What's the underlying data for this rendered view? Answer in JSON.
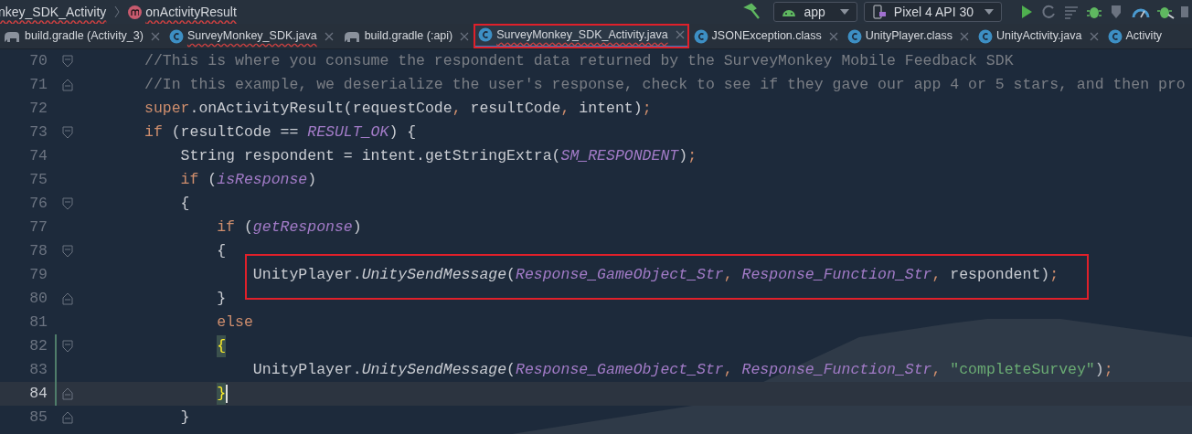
{
  "breadcrumb": {
    "items": [
      {
        "kind": "class",
        "text": "nkey_SDK_Activity",
        "errors": true
      },
      {
        "kind": "method",
        "text": "onActivityResult",
        "errors": true
      }
    ]
  },
  "toolbar": {
    "run_config": "app",
    "device": "Pixel 4 API 30"
  },
  "tabs": [
    {
      "label": "build.gradle (Activity_3)",
      "kind": "gradle",
      "selected": false,
      "errors": false,
      "annotated": false,
      "closable": true
    },
    {
      "label": "SurveyMonkey_SDK.java",
      "kind": "class",
      "selected": false,
      "errors": true,
      "annotated": false,
      "closable": true
    },
    {
      "label": "build.gradle (:api)",
      "kind": "gradle",
      "selected": false,
      "errors": false,
      "annotated": false,
      "closable": true
    },
    {
      "label": "SurveyMonkey_SDK_Activity.java",
      "kind": "class",
      "selected": true,
      "errors": true,
      "annotated": true,
      "closable": true
    },
    {
      "label": "JSONException.class",
      "kind": "class",
      "selected": false,
      "errors": false,
      "annotated": false,
      "closable": true
    },
    {
      "label": "UnityPlayer.class",
      "kind": "class",
      "selected": false,
      "errors": false,
      "annotated": false,
      "closable": true
    },
    {
      "label": "UnityActivity.java",
      "kind": "class",
      "selected": false,
      "errors": false,
      "annotated": false,
      "closable": true
    },
    {
      "label": "Activity",
      "kind": "class",
      "selected": false,
      "errors": false,
      "annotated": false,
      "closable": false
    }
  ],
  "editor": {
    "lines": [
      {
        "number": "70",
        "kind": "fold_start",
        "current": false,
        "changed": false,
        "annotated": false,
        "tokens": [
          {
            "kind": "comment",
            "text": "//This is where you consume the respondent data returned by the SurveyMonkey Mobile Feedback SDK"
          }
        ]
      },
      {
        "number": "71",
        "kind": "fold_end",
        "current": false,
        "changed": false,
        "annotated": false,
        "tokens": [
          {
            "kind": "comment",
            "text": "//In this example, we deserialize the user's response, check to see if they gave our app 4 or 5 stars, and then pro"
          }
        ]
      },
      {
        "number": "72",
        "kind": "plain",
        "current": false,
        "changed": false,
        "annotated": false,
        "tokens": [
          {
            "kind": "keyword",
            "text": "super"
          },
          {
            "kind": "plain",
            "text": ".onActivityResult(requestCode"
          },
          {
            "kind": "punct",
            "text": ", "
          },
          {
            "kind": "plain",
            "text": "resultCode"
          },
          {
            "kind": "punct",
            "text": ", "
          },
          {
            "kind": "plain",
            "text": "intent)"
          },
          {
            "kind": "punct",
            "text": ";"
          }
        ]
      },
      {
        "number": "73",
        "kind": "fold_start",
        "current": false,
        "changed": false,
        "annotated": false,
        "tokens": [
          {
            "kind": "keyword",
            "text": "if"
          },
          {
            "kind": "plain",
            "text": " (resultCode == "
          },
          {
            "kind": "constant",
            "text": "RESULT_OK"
          },
          {
            "kind": "plain",
            "text": ") {"
          }
        ]
      },
      {
        "number": "74",
        "kind": "plain",
        "current": false,
        "changed": false,
        "annotated": false,
        "tokens": [
          {
            "kind": "plain",
            "text": "    String respondent = intent.getStringExtra("
          },
          {
            "kind": "constant",
            "text": "SM_RESPONDENT"
          },
          {
            "kind": "plain",
            "text": ")"
          },
          {
            "kind": "punct",
            "text": ";"
          }
        ]
      },
      {
        "number": "75",
        "kind": "plain",
        "current": false,
        "changed": false,
        "annotated": false,
        "tokens": [
          {
            "kind": "keyword",
            "text": "    if"
          },
          {
            "kind": "plain",
            "text": " ("
          },
          {
            "kind": "constant",
            "text": "isResponse"
          },
          {
            "kind": "plain",
            "text": ")"
          }
        ]
      },
      {
        "number": "76",
        "kind": "fold_start",
        "current": false,
        "changed": false,
        "annotated": false,
        "tokens": [
          {
            "kind": "plain",
            "text": "    {"
          }
        ]
      },
      {
        "number": "77",
        "kind": "plain",
        "current": false,
        "changed": false,
        "annotated": false,
        "tokens": [
          {
            "kind": "keyword",
            "text": "        if"
          },
          {
            "kind": "plain",
            "text": " ("
          },
          {
            "kind": "constant",
            "text": "getResponse"
          },
          {
            "kind": "plain",
            "text": ")"
          }
        ]
      },
      {
        "number": "78",
        "kind": "fold_start",
        "current": false,
        "changed": false,
        "annotated": false,
        "tokens": [
          {
            "kind": "plain",
            "text": "        {"
          }
        ]
      },
      {
        "number": "79",
        "kind": "plain",
        "current": false,
        "changed": false,
        "annotated": true,
        "tokens": [
          {
            "kind": "plain",
            "text": "            UnityPlayer."
          },
          {
            "kind": "method",
            "text": "UnitySendMessage"
          },
          {
            "kind": "plain",
            "text": "("
          },
          {
            "kind": "constant",
            "text": "Response_GameObject_Str"
          },
          {
            "kind": "punct",
            "text": ", "
          },
          {
            "kind": "constant",
            "text": "Response_Function_Str"
          },
          {
            "kind": "punct",
            "text": ", "
          },
          {
            "kind": "plain",
            "text": "respondent)"
          },
          {
            "kind": "punct",
            "text": ";"
          }
        ]
      },
      {
        "number": "80",
        "kind": "fold_end",
        "current": false,
        "changed": false,
        "annotated": false,
        "tokens": [
          {
            "kind": "plain",
            "text": "        }"
          }
        ]
      },
      {
        "number": "81",
        "kind": "plain",
        "current": false,
        "changed": false,
        "annotated": false,
        "tokens": [
          {
            "kind": "keyword",
            "text": "        else"
          }
        ]
      },
      {
        "number": "82",
        "kind": "fold_start",
        "current": false,
        "changed": true,
        "annotated": false,
        "tokens": [
          {
            "kind": "brace_match",
            "text": "        {"
          }
        ]
      },
      {
        "number": "83",
        "kind": "plain",
        "current": false,
        "changed": true,
        "annotated": false,
        "tokens": [
          {
            "kind": "plain",
            "text": "            UnityPlayer."
          },
          {
            "kind": "method",
            "text": "UnitySendMessage"
          },
          {
            "kind": "plain",
            "text": "("
          },
          {
            "kind": "constant",
            "text": "Response_GameObject_Str"
          },
          {
            "kind": "punct",
            "text": ", "
          },
          {
            "kind": "constant",
            "text": "Response_Function_Str"
          },
          {
            "kind": "punct",
            "text": ", "
          },
          {
            "kind": "string",
            "text": "\"completeSurvey\""
          },
          {
            "kind": "plain",
            "text": ")"
          },
          {
            "kind": "punct",
            "text": ";"
          }
        ]
      },
      {
        "number": "84",
        "kind": "fold_end",
        "current": true,
        "changed": true,
        "annotated": false,
        "tokens": [
          {
            "kind": "brace_match",
            "text": "        }"
          }
        ]
      },
      {
        "number": "85",
        "kind": "fold_end",
        "current": false,
        "changed": false,
        "annotated": false,
        "tokens": [
          {
            "kind": "plain",
            "text": "    }"
          }
        ]
      }
    ]
  }
}
